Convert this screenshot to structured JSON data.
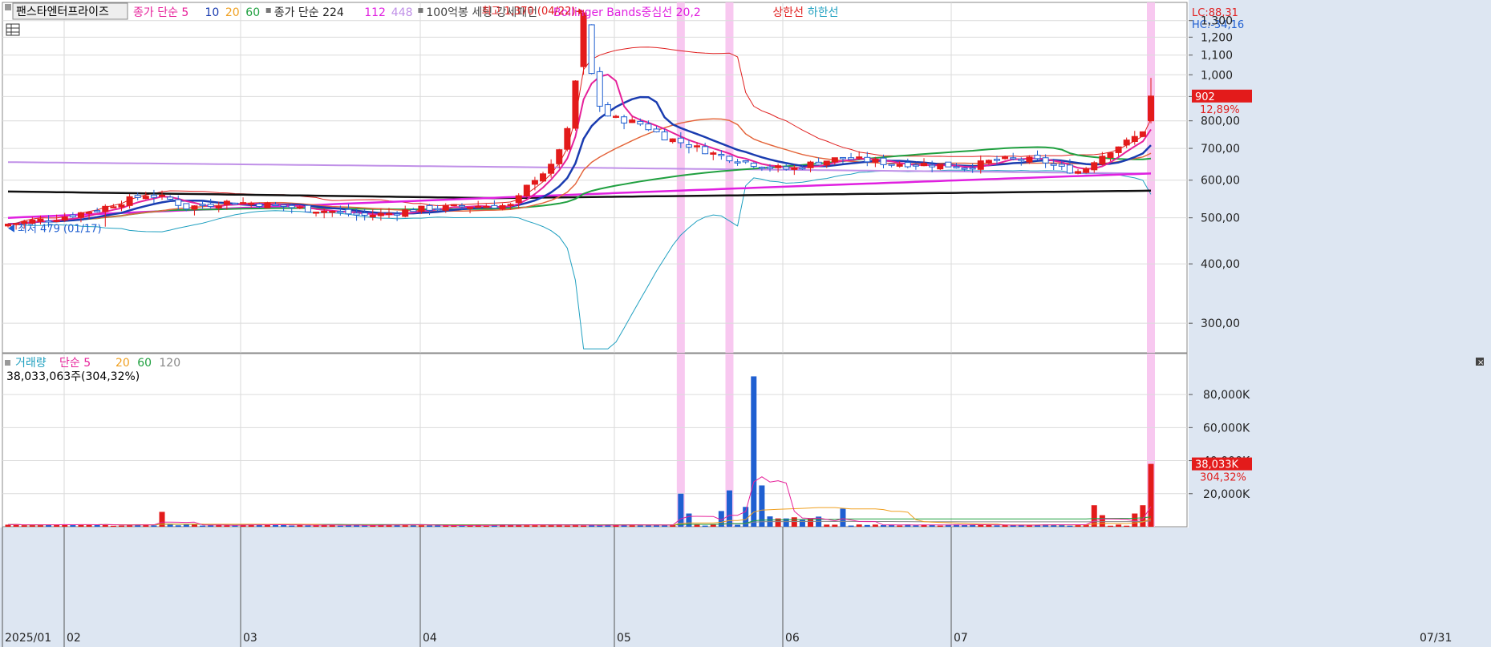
{
  "chart_data": {
    "type": "candlestick",
    "stock_name": "팬스타엔터프라이즈",
    "price_legend": [
      {
        "text": "종가 단순 5",
        "color": "#e6219a"
      },
      {
        "text": "10",
        "color": "#1a3cb0"
      },
      {
        "text": "20",
        "color": "#f0a020"
      },
      {
        "text": "60",
        "color": "#20a040"
      },
      {
        "text": "종가 단순 224",
        "color": "#222222"
      },
      {
        "text": "112",
        "color": "#e020e0"
      },
      {
        "text": "448",
        "color": "#c090e8"
      },
      {
        "text": "100억봉 세팅 강세패턴",
        "color": "#444444"
      },
      {
        "text": "Bollinger Bands중심선 20,2",
        "color": "#e020e0"
      },
      {
        "text": "상한선",
        "color": "#e02020"
      },
      {
        "text": "하한선",
        "color": "#20a0c0"
      }
    ],
    "lc_label": "LC:88,31",
    "hc_label": "HC:-34,16",
    "high_annotation": "최고 1,370 (04/22)",
    "low_annotation": "최저 479 (01/17)",
    "current_price": "902",
    "current_change": "12,89%",
    "price_axis": {
      "scale": "log",
      "range": [
        260,
        1420
      ],
      "tick_labels": [
        "1,300",
        "1,200",
        "1,100",
        "1,000",
        "900",
        "800,00",
        "700,00",
        "600,00",
        "500,00",
        "400,00",
        "300,00"
      ],
      "tick_values": [
        1300,
        1200,
        1100,
        1000,
        900,
        800,
        700,
        600,
        500,
        400,
        300
      ]
    },
    "x_labels": [
      "2025/01",
      "02",
      "03",
      "04",
      "05",
      "06",
      "07"
    ],
    "x_end_label": "07/31",
    "volume_legend": [
      {
        "text": "거래량",
        "color": "#20a0c0"
      },
      {
        "text": "단순 5",
        "color": "#e6219a"
      },
      {
        "text": "20",
        "color": "#f0a020"
      },
      {
        "text": "60",
        "color": "#20a040"
      },
      {
        "text": "120",
        "color": "#888888"
      }
    ],
    "volume_info": "38,033,063주(304,32%)",
    "volume_axis": {
      "tick_labels": [
        "80,000K",
        "60,000K",
        "40,000K",
        "20,000K"
      ],
      "tick_values": [
        80000,
        60000,
        40000,
        20000
      ],
      "max": 98000
    },
    "current_volume": "38,033K",
    "current_volume_pct": "304,32%",
    "colors": {
      "up": "#e31b1b",
      "down": "#1f5fd1",
      "highlight": "#f8c8f0"
    }
  }
}
